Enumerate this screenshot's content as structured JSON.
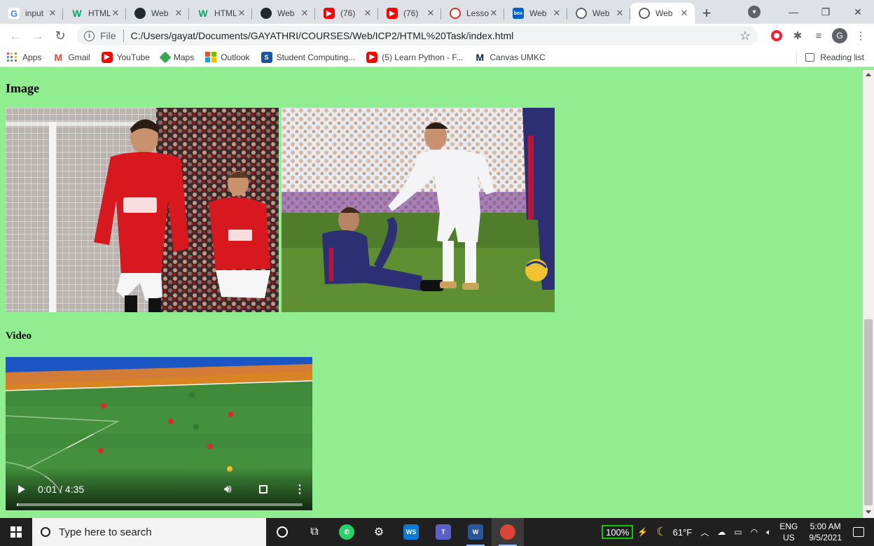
{
  "browser": {
    "tabs": [
      {
        "title": "input",
        "icon": "google-icon",
        "active": false
      },
      {
        "title": "HTML",
        "icon": "w3schools-icon",
        "active": false
      },
      {
        "title": "Web",
        "icon": "github-icon",
        "active": false
      },
      {
        "title": "HTML",
        "icon": "w3schools-icon",
        "active": false
      },
      {
        "title": "Web",
        "icon": "github-icon",
        "active": false
      },
      {
        "title": "(76)",
        "icon": "youtube-icon",
        "active": false
      },
      {
        "title": "(76)",
        "icon": "youtube-icon",
        "active": false
      },
      {
        "title": "Lesso",
        "icon": "lesson-icon",
        "active": false
      },
      {
        "title": "Web",
        "icon": "box-icon",
        "active": false
      },
      {
        "title": "Web",
        "icon": "globe-icon",
        "active": false
      },
      {
        "title": "Web",
        "icon": "globe-icon",
        "active": true
      }
    ],
    "close_glyph": "✕",
    "new_tab_glyph": "+",
    "address": {
      "scheme": "File",
      "url": "C:/Users/gayat/Documents/GAYATHRI/COURSES/Web/ICP2/HTML%20Task/index.html"
    },
    "profile_initial": "G",
    "bookmarks": [
      {
        "label": "Apps",
        "icon": "apps-grid-icon"
      },
      {
        "label": "Gmail",
        "icon": "gmail-icon"
      },
      {
        "label": "YouTube",
        "icon": "youtube-icon"
      },
      {
        "label": "Maps",
        "icon": "maps-icon"
      },
      {
        "label": "Outlook",
        "icon": "outlook-icon"
      },
      {
        "label": "Student Computing...",
        "icon": "student-computing-icon"
      },
      {
        "label": "(5) Learn Python - F...",
        "icon": "youtube-icon"
      },
      {
        "label": "Canvas UMKC",
        "icon": "canvas-icon"
      }
    ],
    "reading_list": "Reading list"
  },
  "page": {
    "image_heading": "Image",
    "video_heading": "Video",
    "video": {
      "time": "0:01 / 4:35",
      "progress": 0.004
    }
  },
  "taskbar": {
    "search_placeholder": "Type here to search",
    "battery": "100%",
    "temperature": "61°F",
    "language": "ENG",
    "region": "US",
    "time": "5:00 AM",
    "date": "9/5/2021"
  },
  "colors": {
    "page_background": "#90ee90",
    "tab_strip": "#dee1e6",
    "taskbar": "#202020",
    "battery_outline": "#16c60c"
  }
}
